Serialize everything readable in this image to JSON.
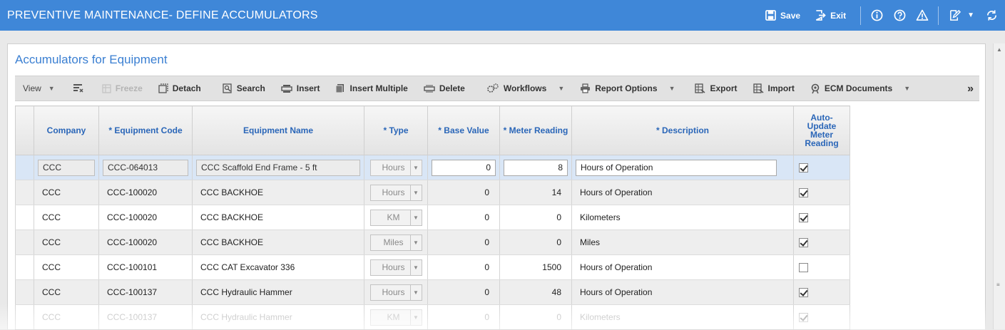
{
  "app": {
    "title": "PREVENTIVE MAINTENANCE- DEFINE ACCUMULATORS",
    "save_label": "Save",
    "exit_label": "Exit"
  },
  "panel": {
    "title": "Accumulators for Equipment"
  },
  "toolbar": {
    "view": "View",
    "freeze": "Freeze",
    "detach": "Detach",
    "search": "Search",
    "insert": "Insert",
    "insert_multiple": "Insert Multiple",
    "delete": "Delete",
    "workflows": "Workflows",
    "report_options": "Report Options",
    "export": "Export",
    "import": "Import",
    "ecm_documents": "ECM Documents",
    "more": "»"
  },
  "grid": {
    "columns": [
      "Company",
      "* Equipment Code",
      "Equipment Name",
      "* Type",
      "* Base Value",
      "* Meter Reading",
      "* Description",
      "Auto-Update Meter Reading"
    ],
    "rows": [
      {
        "company": "CCC",
        "code": "CCC-064013",
        "name": "CCC Scaffold End Frame - 5 ft",
        "type": "Hours",
        "base": "0",
        "meter": "8",
        "desc": "Hours of Operation",
        "auto": true
      },
      {
        "company": "CCC",
        "code": "CCC-100020",
        "name": "CCC BACKHOE",
        "type": "Hours",
        "base": "0",
        "meter": "14",
        "desc": "Hours of Operation",
        "auto": true
      },
      {
        "company": "CCC",
        "code": "CCC-100020",
        "name": "CCC BACKHOE",
        "type": "KM",
        "base": "0",
        "meter": "0",
        "desc": "Kilometers",
        "auto": true
      },
      {
        "company": "CCC",
        "code": "CCC-100020",
        "name": "CCC BACKHOE",
        "type": "Miles",
        "base": "0",
        "meter": "0",
        "desc": "Miles",
        "auto": true
      },
      {
        "company": "CCC",
        "code": "CCC-100101",
        "name": "CCC CAT Excavator 336",
        "type": "Hours",
        "base": "0",
        "meter": "1500",
        "desc": "Hours of Operation",
        "auto": false
      },
      {
        "company": "CCC",
        "code": "CCC-100137",
        "name": "CCC Hydraulic Hammer",
        "type": "Hours",
        "base": "0",
        "meter": "48",
        "desc": "Hours of Operation",
        "auto": true
      },
      {
        "company": "CCC",
        "code": "CCC-100137",
        "name": "CCC Hydraulic Hammer",
        "type": "KM",
        "base": "0",
        "meter": "0",
        "desc": "Kilometers",
        "auto": true
      }
    ]
  }
}
